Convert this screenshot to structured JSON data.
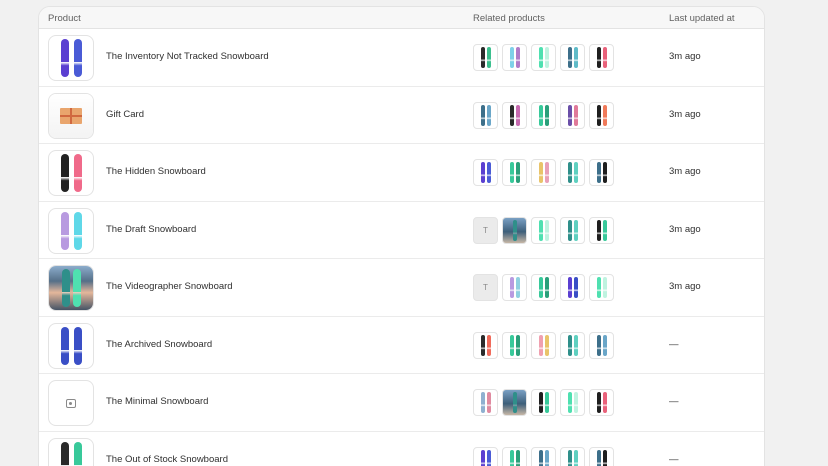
{
  "table": {
    "headers": {
      "product": "Product",
      "related": "Related products",
      "updated": "Last updated at"
    },
    "rows": [
      {
        "name": "The Inventory Not Tracked Snowboard",
        "updated": "3m ago",
        "thumb": {
          "kind": "boards",
          "colors": [
            "#5b3fd1",
            "#4a5bd6"
          ]
        },
        "related": [
          {
            "kind": "boards",
            "colors": [
              "#2a2a2a",
              "#3bbf8e"
            ]
          },
          {
            "kind": "boards",
            "colors": [
              "#7fd0e8",
              "#b07bc8"
            ]
          },
          {
            "kind": "boards",
            "colors": [
              "#4fe0b0",
              "#bff3e0"
            ]
          },
          {
            "kind": "boards",
            "colors": [
              "#3d6f8a",
              "#5fbbc8"
            ]
          },
          {
            "kind": "boards",
            "colors": [
              "#1f1f1f",
              "#e9627b"
            ]
          }
        ]
      },
      {
        "name": "Gift Card",
        "updated": "3m ago",
        "thumb": {
          "kind": "gift"
        },
        "related": [
          {
            "kind": "boards",
            "colors": [
              "#3d6f8a",
              "#6aa6c8"
            ]
          },
          {
            "kind": "boards",
            "colors": [
              "#2a2a2a",
              "#c76ab0"
            ]
          },
          {
            "kind": "boards",
            "colors": [
              "#38c99a",
              "#2aa07a"
            ]
          },
          {
            "kind": "boards",
            "colors": [
              "#6a4fa8",
              "#e07a9a"
            ]
          },
          {
            "kind": "boards",
            "colors": [
              "#1f1f1f",
              "#f07a5a"
            ]
          }
        ]
      },
      {
        "name": "The Hidden Snowboard",
        "updated": "3m ago",
        "thumb": {
          "kind": "boards",
          "colors": [
            "#222222",
            "#f06a8a"
          ]
        },
        "related": [
          {
            "kind": "boards",
            "colors": [
              "#5b3fd1",
              "#4a5bd6"
            ]
          },
          {
            "kind": "boards",
            "colors": [
              "#38c99a",
              "#2aa07a"
            ]
          },
          {
            "kind": "boards",
            "colors": [
              "#e9c46a",
              "#e8a0b8"
            ]
          },
          {
            "kind": "boards",
            "colors": [
              "#2f8f8a",
              "#5fd0c0"
            ]
          },
          {
            "kind": "boards",
            "colors": [
              "#3d6f8a",
              "#1f1f1f"
            ]
          }
        ]
      },
      {
        "name": "The Draft Snowboard",
        "updated": "3m ago",
        "thumb": {
          "kind": "boards",
          "colors": [
            "#b89ae0",
            "#5fd8e8"
          ]
        },
        "related": [
          {
            "kind": "letter",
            "text": "T"
          },
          {
            "kind": "photo"
          },
          {
            "kind": "boards",
            "colors": [
              "#4fe0b0",
              "#bff3e0"
            ]
          },
          {
            "kind": "boards",
            "colors": [
              "#2f8f8a",
              "#5fd0c0"
            ]
          },
          {
            "kind": "boards",
            "colors": [
              "#1f1f1f",
              "#38c99a"
            ]
          }
        ]
      },
      {
        "name": "The Videographer Snowboard",
        "updated": "3m ago",
        "thumb": {
          "kind": "photo"
        },
        "related": [
          {
            "kind": "letter",
            "text": "T"
          },
          {
            "kind": "boards",
            "colors": [
              "#b89ae0",
              "#8fd0e0"
            ]
          },
          {
            "kind": "boards",
            "colors": [
              "#38c99a",
              "#2aa07a"
            ]
          },
          {
            "kind": "boards",
            "colors": [
              "#5b3fd1",
              "#3a4fc6"
            ]
          },
          {
            "kind": "boards",
            "colors": [
              "#4fe0b0",
              "#bff3e0"
            ]
          }
        ]
      },
      {
        "name": "The Archived Snowboard",
        "updated": "—",
        "thumb": {
          "kind": "boards",
          "colors": [
            "#3a4fc6",
            "#3a4fc6"
          ]
        },
        "related": [
          {
            "kind": "boards",
            "colors": [
              "#2a2a2a",
              "#f06a5a"
            ]
          },
          {
            "kind": "boards",
            "colors": [
              "#38c99a",
              "#2aa07a"
            ]
          },
          {
            "kind": "boards",
            "colors": [
              "#f0a0b0",
              "#e9c46a"
            ]
          },
          {
            "kind": "boards",
            "colors": [
              "#2f8f8a",
              "#5fd0c0"
            ]
          },
          {
            "kind": "boards",
            "colors": [
              "#3d6f8a",
              "#6aa6c8"
            ]
          }
        ]
      },
      {
        "name": "The Minimal Snowboard",
        "updated": "—",
        "thumb": {
          "kind": "placeholder"
        },
        "related": [
          {
            "kind": "boards",
            "colors": [
              "#8fb0d0",
              "#e08aa0"
            ]
          },
          {
            "kind": "photo"
          },
          {
            "kind": "boards",
            "colors": [
              "#1f1f1f",
              "#38c99a"
            ]
          },
          {
            "kind": "boards",
            "colors": [
              "#4fe0b0",
              "#bff3e0"
            ]
          },
          {
            "kind": "boards",
            "colors": [
              "#1f1f1f",
              "#e9627b"
            ]
          }
        ]
      },
      {
        "name": "The Out of Stock Snowboard",
        "updated": "—",
        "thumb": {
          "kind": "boards",
          "colors": [
            "#2a2a2a",
            "#38c99a"
          ]
        },
        "related": [
          {
            "kind": "boards",
            "colors": [
              "#5b3fd1",
              "#4a5bd6"
            ]
          },
          {
            "kind": "boards",
            "colors": [
              "#38c99a",
              "#2aa07a"
            ]
          },
          {
            "kind": "boards",
            "colors": [
              "#3d6f8a",
              "#6aa6c8"
            ]
          },
          {
            "kind": "boards",
            "colors": [
              "#2f8f8a",
              "#5fd0c0"
            ]
          },
          {
            "kind": "boards",
            "colors": [
              "#3d6f8a",
              "#1f1f1f"
            ]
          }
        ]
      }
    ]
  }
}
